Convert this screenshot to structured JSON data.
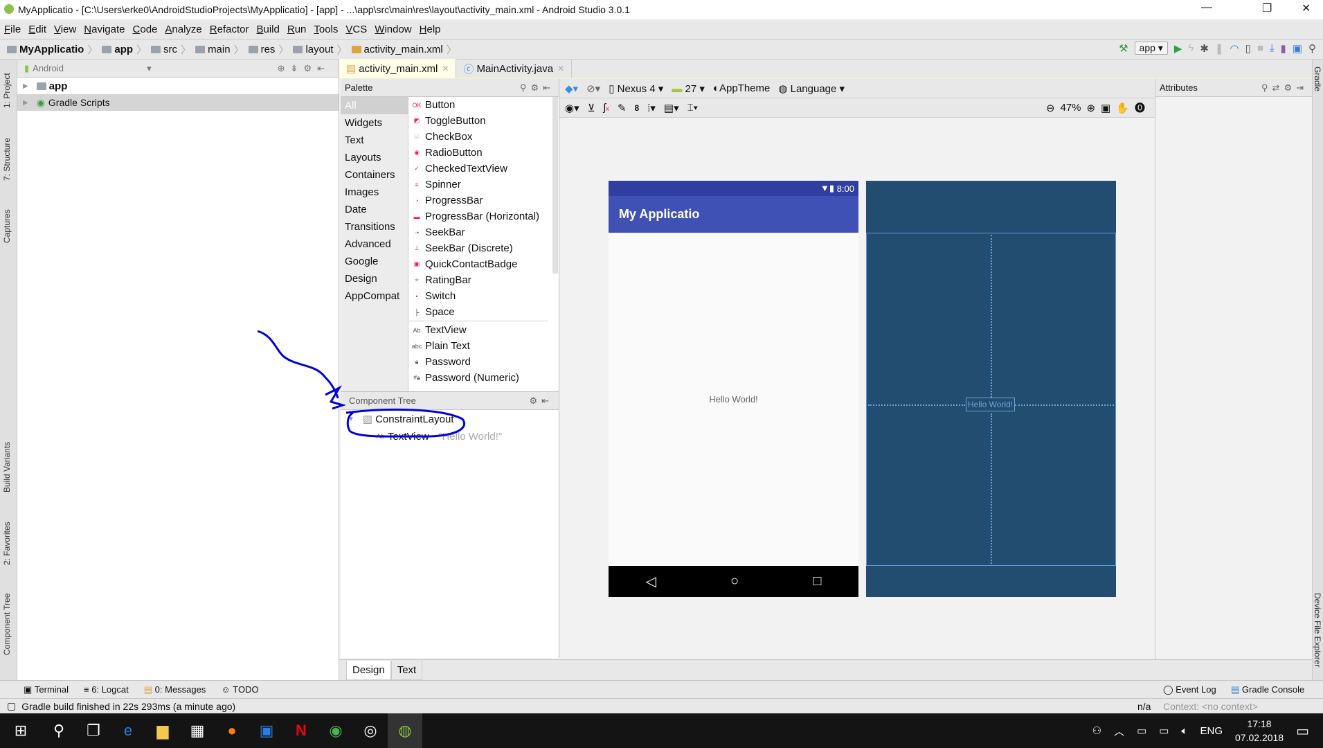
{
  "window": {
    "title": "MyApplicatio - [C:\\Users\\erke0\\AndroidStudioProjects\\MyApplicatio] - [app] - ...\\app\\src\\main\\res\\layout\\activity_main.xml - Android Studio 3.0.1",
    "minimize": "—",
    "maximize": "❐",
    "close": "✕"
  },
  "menu": [
    "File",
    "Edit",
    "View",
    "Navigate",
    "Code",
    "Analyze",
    "Refactor",
    "Build",
    "Run",
    "Tools",
    "VCS",
    "Window",
    "Help"
  ],
  "breadcrumb": [
    "MyApplicatio",
    "app",
    "src",
    "main",
    "res",
    "layout",
    "activity_main.xml"
  ],
  "toolbar": {
    "run_config": "app"
  },
  "left_stripe": [
    "1: Project",
    "7: Structure",
    "Captures",
    "Build Variants",
    "2: Favorites",
    "Component Tree"
  ],
  "right_stripe": [
    "Gradle",
    "Device File Explorer"
  ],
  "project": {
    "view": "Android",
    "items": [
      "app",
      "Gradle Scripts"
    ]
  },
  "editor_tabs": [
    {
      "label": "activity_main.xml",
      "active": true
    },
    {
      "label": "MainActivity.java",
      "active": false
    }
  ],
  "palette": {
    "title": "Palette",
    "categories": [
      "All",
      "Widgets",
      "Text",
      "Layouts",
      "Containers",
      "Images",
      "Date",
      "Transitions",
      "Advanced",
      "Google",
      "Design",
      "AppCompat"
    ],
    "items": [
      "Button",
      "ToggleButton",
      "CheckBox",
      "RadioButton",
      "CheckedTextView",
      "Spinner",
      "ProgressBar",
      "ProgressBar (Horizontal)",
      "SeekBar",
      "SeekBar (Discrete)",
      "QuickContactBadge",
      "RatingBar",
      "Switch",
      "Space"
    ],
    "text_items": [
      "TextView",
      "Plain Text",
      "Password",
      "Password (Numeric)"
    ]
  },
  "component_tree": {
    "title": "Component Tree",
    "root": "ConstraintLayout",
    "child": "TextView",
    "child_text": "- \"Hello World!\""
  },
  "design_toolbar": {
    "device": "Nexus 4",
    "api": "27",
    "theme": "AppTheme",
    "language": "Language",
    "margin": "8",
    "zoom": "47%"
  },
  "attributes": {
    "title": "Attributes"
  },
  "phone": {
    "time": "8:00",
    "app_title": "My Applicatio",
    "hello": "Hello World!",
    "appbar_color": "#3f51b5",
    "statusbar_color": "#303f9f"
  },
  "blueprint": {
    "hello": "Hello World!",
    "color": "#224d70"
  },
  "design_tabs": [
    "Design",
    "Text"
  ],
  "tool_windows": [
    "Terminal",
    "6: Logcat",
    "0: Messages",
    "TODO"
  ],
  "tool_windows_right": [
    "Event Log",
    "Gradle Console"
  ],
  "status": {
    "message": "Gradle build finished in 22s 293ms (a minute ago)",
    "position": "n/a",
    "context": "Context: <no context>"
  },
  "taskbar": {
    "lang": "ENG",
    "time": "17:18",
    "date": "07.02.2018"
  },
  "annotation_color": "#0000e0"
}
